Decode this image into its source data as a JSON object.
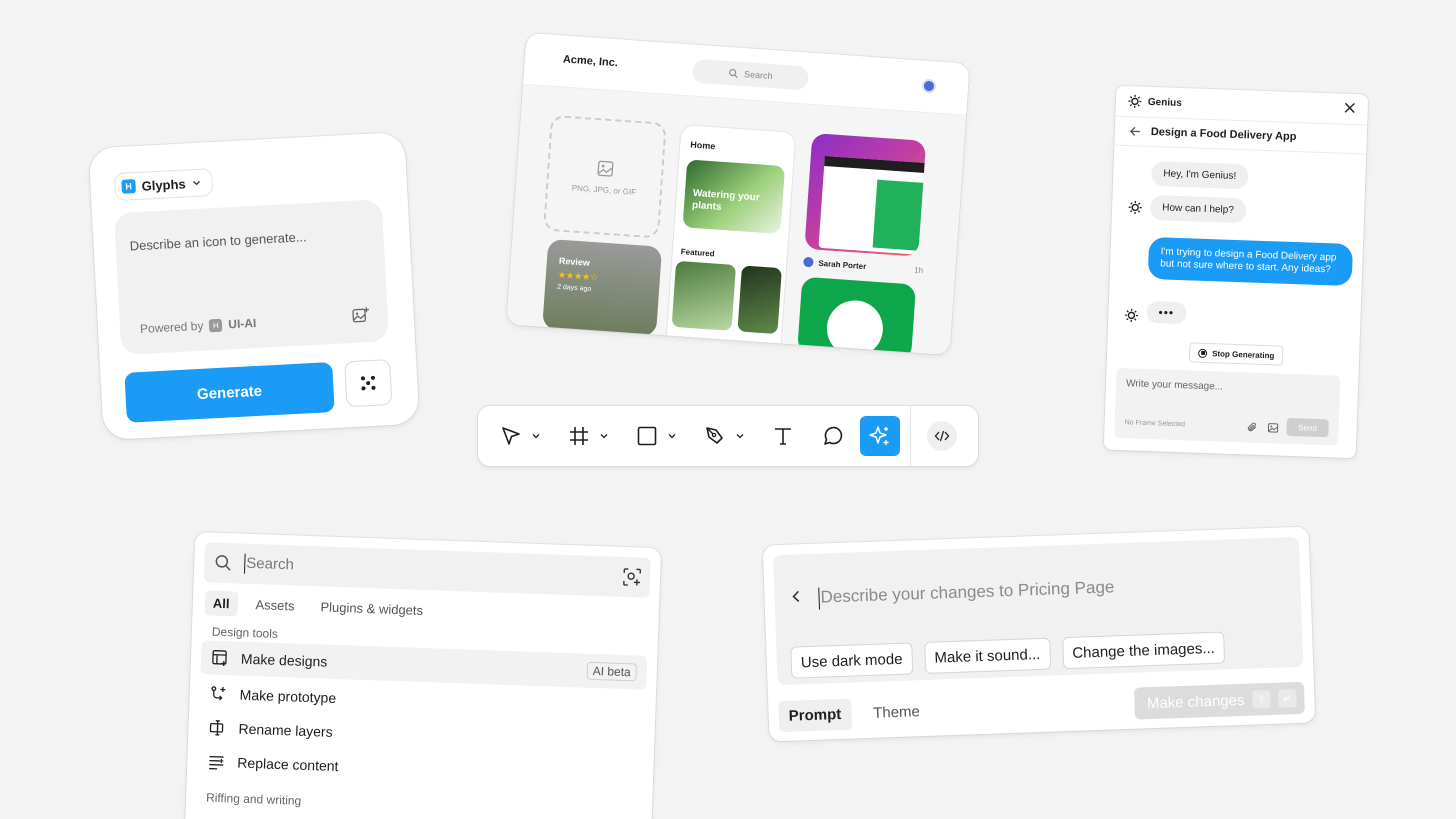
{
  "glyphs": {
    "picker_label": "Glyphs",
    "picker_logo": "H",
    "placeholder": "Describe an icon to generate...",
    "powered_by": "Powered by",
    "powered_brand": "UI-AI",
    "generate_label": "Generate",
    "accent": "#1a9bf5"
  },
  "acme": {
    "brand": "Acme, Inc.",
    "search_placeholder": "Search",
    "upload_hint": "PNG, JPG, or GIF",
    "home_title": "Home",
    "card_caption": "Watering your plants",
    "featured_label": "Featured",
    "review_title": "Review",
    "review_stars": "★★★★☆",
    "review_time": "2 days ago",
    "author": "Sarah Porter",
    "author_time": "1h"
  },
  "toolbar": {
    "tools": [
      "move-tool",
      "frame-tool",
      "rectangle-tool",
      "pen-tool",
      "text-tool",
      "comment-tool",
      "ai-tool",
      "code-tool"
    ],
    "accent": "#1a9bf5"
  },
  "genius": {
    "title": "Genius",
    "thread_title": "Design a Food Delivery App",
    "msg_greeting": "Hey, I'm Genius!",
    "msg_help": "How can I help?",
    "msg_user": "I'm trying to design a Food Delivery app but not sure where to start. Any ideas?",
    "typing": "•••",
    "stop_label": "Stop Generating",
    "input_placeholder": "Write your message...",
    "no_frame": "No Frame Selected",
    "send_label": "Send"
  },
  "actions": {
    "search_placeholder": "Search",
    "tabs": [
      "All",
      "Assets",
      "Plugins & widgets"
    ],
    "section_design": "Design tools",
    "items": [
      {
        "label": "Make designs",
        "badge": "AI beta"
      },
      {
        "label": "Make prototype"
      },
      {
        "label": "Rename layers"
      },
      {
        "label": "Replace content"
      }
    ],
    "section_writing": "Riffing and writing"
  },
  "prompt": {
    "placeholder": "Describe your changes to Pricing Page",
    "chips": [
      "Use dark mode",
      "Make it sound...",
      "Change the images..."
    ],
    "tabs": [
      "Prompt",
      "Theme"
    ],
    "submit_label": "Make changes",
    "key_shift": "⇧",
    "key_enter": "↵"
  }
}
